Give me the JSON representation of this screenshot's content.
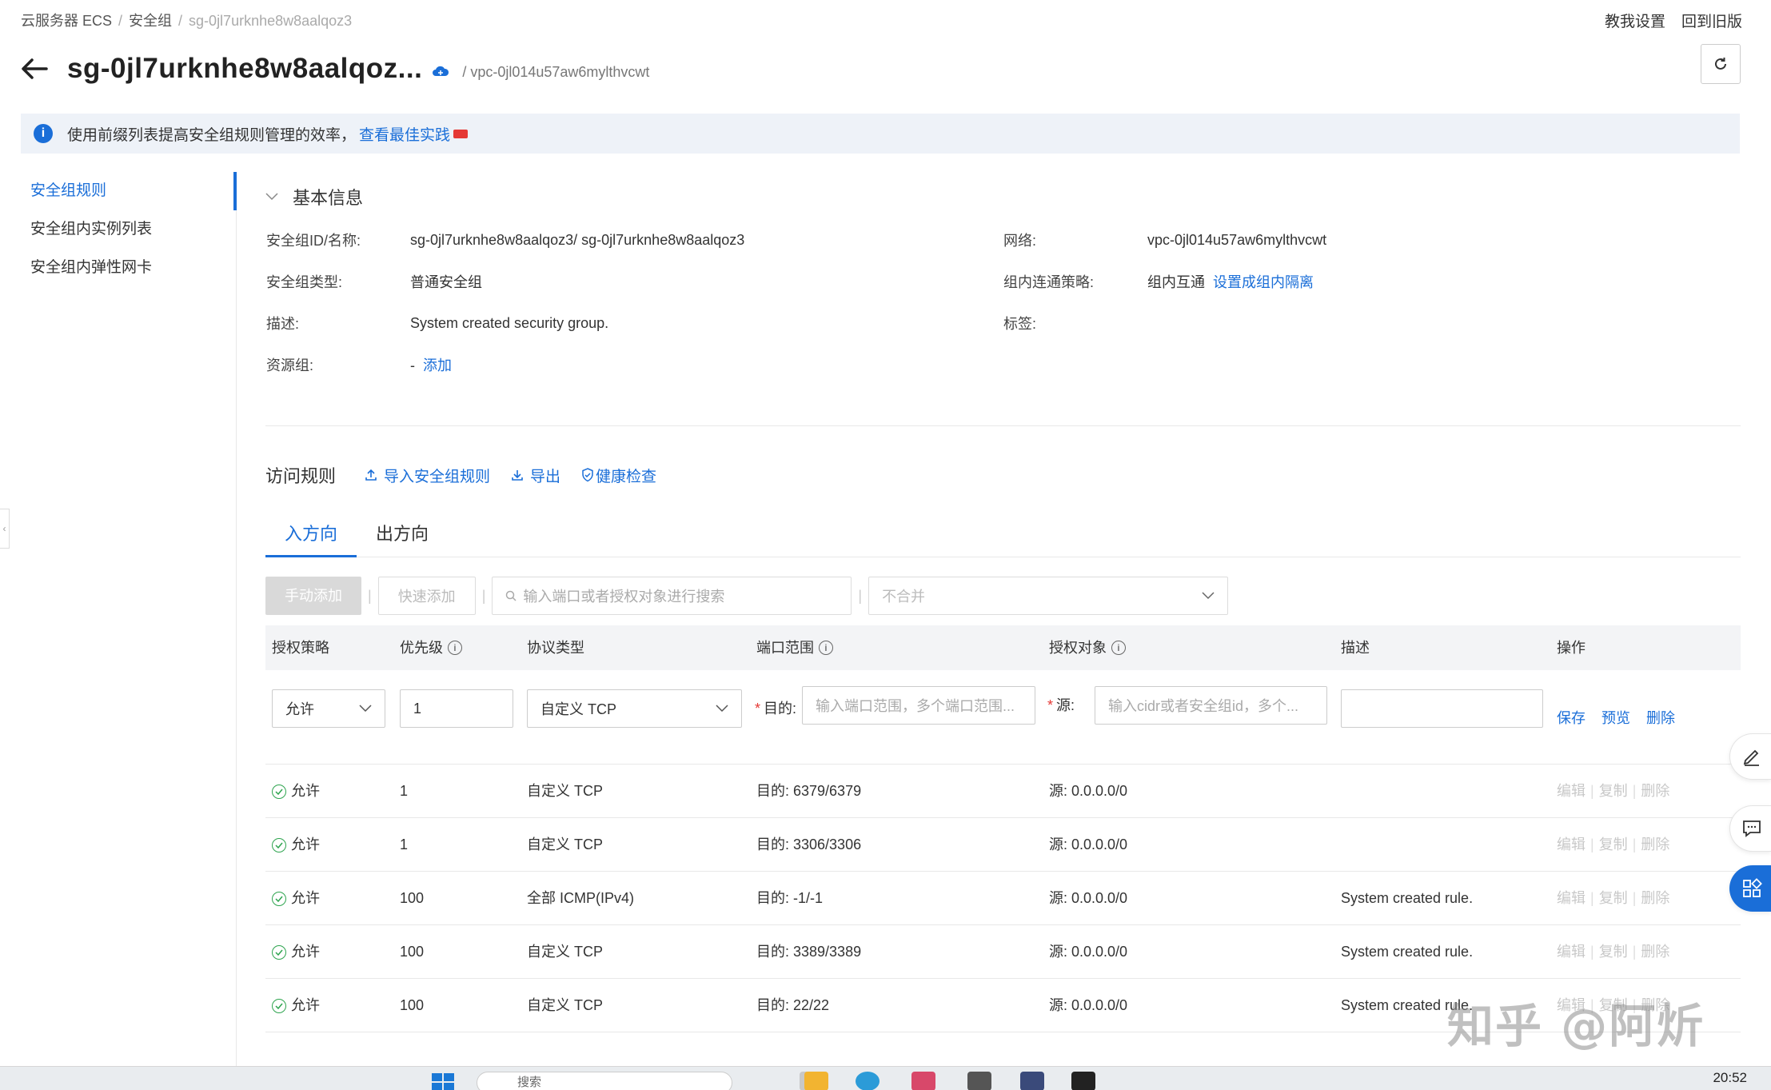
{
  "breadcrumb": {
    "item1": "云服务器 ECS",
    "item2": "安全组",
    "item3": "sg-0jl7urknhe8w8aalqoz3"
  },
  "top_links": {
    "tutorial": "教我设置",
    "old_version": "回到旧版"
  },
  "header": {
    "title": "sg-0jl7urknhe8w8aalqoz...",
    "vpc": "/ vpc-0jl014u57aw6mylthvcwt"
  },
  "notice": {
    "text": "使用前缀列表提高安全组规则管理的效率，",
    "link": "查看最佳实践"
  },
  "side_nav": {
    "items": [
      "安全组规则",
      "安全组内实例列表",
      "安全组内弹性网卡"
    ]
  },
  "basic_info": {
    "title": "基本信息",
    "id_label": "安全组ID/名称:",
    "id_value": "sg-0jl7urknhe8w8aalqoz3/ sg-0jl7urknhe8w8aalqoz3",
    "type_label": "安全组类型:",
    "type_value": "普通安全组",
    "desc_label": "描述:",
    "desc_value": "System created security group.",
    "rg_label": "资源组:",
    "rg_value": "-",
    "rg_link": "添加",
    "net_label": "网络:",
    "net_value": "vpc-0jl014u57aw6mylthvcwt",
    "policy_label": "组内连通策略:",
    "policy_value": "组内互通",
    "policy_link": "设置成组内隔离",
    "tag_label": "标签:"
  },
  "rules": {
    "title": "访问规则",
    "import": "导入安全组规则",
    "export": "导出",
    "health": "健康检查",
    "tabs": [
      "入方向",
      "出方向"
    ]
  },
  "toolbar": {
    "manual_add": "手动添加",
    "quick_add": "快速添加",
    "search_placeholder": "输入端口或者授权对象进行搜索",
    "merge_select": "不合并"
  },
  "table": {
    "headers": {
      "policy": "授权策略",
      "priority": "优先级",
      "protocol": "协议类型",
      "port": "端口范围",
      "target": "授权对象",
      "desc": "描述",
      "ops": "操作"
    },
    "edit_row": {
      "policy": "允许",
      "priority": "1",
      "protocol": "自定义 TCP",
      "port_label": "目的:",
      "port_placeholder": "输入端口范围，多个端口范围...",
      "target_label": "源:",
      "target_placeholder": "输入cidr或者安全组id，多个...",
      "save": "保存",
      "preview": "预览",
      "delete": "删除"
    },
    "ops": {
      "edit": "编辑",
      "copy": "复制",
      "delete": "删除"
    },
    "rows": [
      {
        "policy": "允许",
        "priority": "1",
        "protocol": "自定义 TCP",
        "port": "目的: 6379/6379",
        "target": "源: 0.0.0.0/0",
        "desc": ""
      },
      {
        "policy": "允许",
        "priority": "1",
        "protocol": "自定义 TCP",
        "port": "目的: 3306/3306",
        "target": "源: 0.0.0.0/0",
        "desc": ""
      },
      {
        "policy": "允许",
        "priority": "100",
        "protocol": "全部 ICMP(IPv4)",
        "port": "目的: -1/-1",
        "target": "源: 0.0.0.0/0",
        "desc": "System created rule."
      },
      {
        "policy": "允许",
        "priority": "100",
        "protocol": "自定义 TCP",
        "port": "目的: 3389/3389",
        "target": "源: 0.0.0.0/0",
        "desc": "System created rule."
      },
      {
        "policy": "允许",
        "priority": "100",
        "protocol": "自定义 TCP",
        "port": "目的: 22/22",
        "target": "源: 0.0.0.0/0",
        "desc": "System created rule."
      }
    ]
  },
  "watermark": "知乎 @阿炘",
  "taskbar": {
    "search": "搜索",
    "time": "20:52"
  },
  "colors": {
    "accent": "#1a6ed8",
    "success": "#2ea44f",
    "required": "#e53935"
  }
}
